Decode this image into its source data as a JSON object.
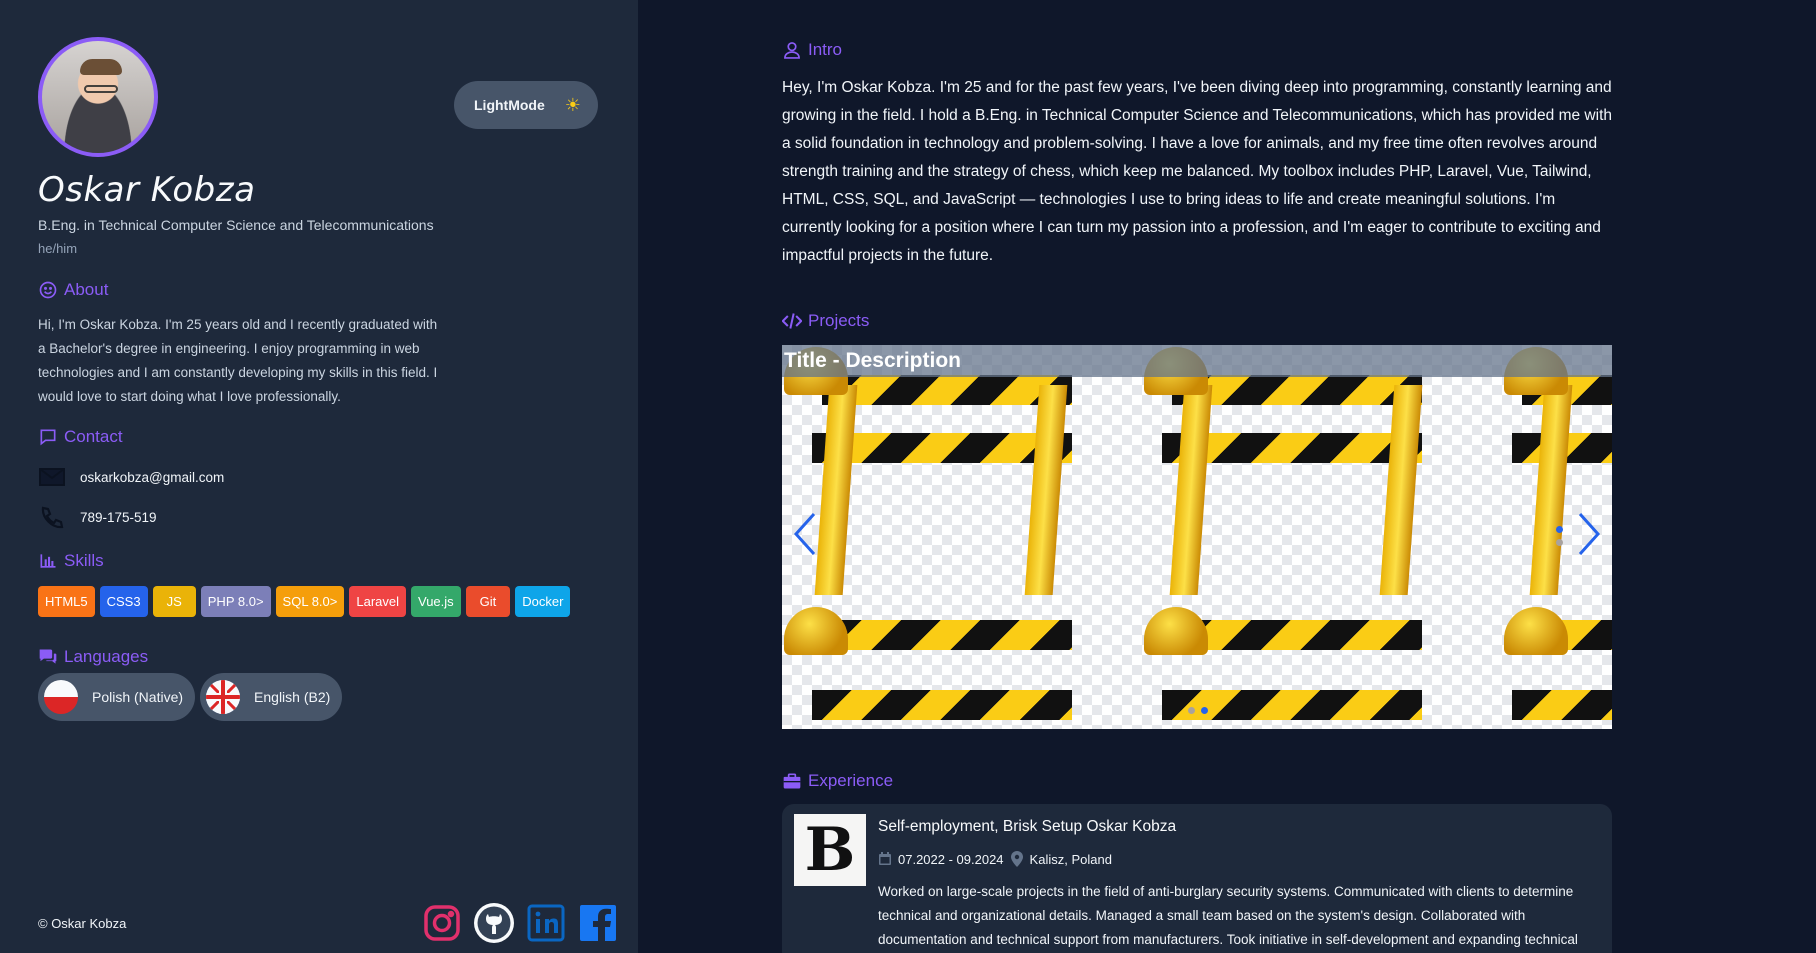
{
  "profile": {
    "name": "Oskar Kobza",
    "degree": "B.Eng. in Technical Computer Science and Telecommunications",
    "pronouns": "he/him"
  },
  "theme_toggle": {
    "label": "LightMode",
    "icon": "sun-icon"
  },
  "about": {
    "heading": "About",
    "text": "Hi, I'm Oskar Kobza. I'm 25 years old and I recently graduated with a Bachelor's degree in engineering. I enjoy programming in web technologies and I am constantly developing my skills in this field. I would love to start doing what I love professionally."
  },
  "contact": {
    "heading": "Contact",
    "email": "oskarkobza@gmail.com",
    "phone": "789-175-519"
  },
  "skills": {
    "heading": "Skills",
    "items": [
      {
        "label": "HTML5",
        "color": "#f97316"
      },
      {
        "label": "CSS3",
        "color": "#2563eb"
      },
      {
        "label": "JS",
        "color": "#eab308"
      },
      {
        "label": "PHP 8.0>",
        "color": "#7c7fb8"
      },
      {
        "label": "SQL 8.0>",
        "color": "#f59e0b"
      },
      {
        "label": "Laravel",
        "color": "#ef4444"
      },
      {
        "label": "Vue.js",
        "color": "#34a86a"
      },
      {
        "label": "Git",
        "color": "#ea4c2c"
      },
      {
        "label": "Docker",
        "color": "#0ea5e9"
      }
    ]
  },
  "languages": {
    "heading": "Languages",
    "items": [
      {
        "label": "Polish (Native)",
        "flag": "poland-flag-icon"
      },
      {
        "label": "English (B2)",
        "flag": "uk-flag-icon"
      }
    ]
  },
  "footer": {
    "copyright": "© Oskar Kobza",
    "socials": [
      "instagram-icon",
      "github-icon",
      "linkedin-icon",
      "facebook-icon"
    ]
  },
  "intro": {
    "heading": "Intro",
    "text": "Hey, I'm Oskar Kobza. I'm 25 and for the past few years, I've been diving deep into programming, constantly learning and growing in the field. I hold a B.Eng. in Technical Computer Science and Telecommunications, which has provided me with a solid foundation in technology and problem-solving. I have a love for animals, and my free time often revolves around strength training and the strategy of chess, which keep me balanced. My toolbox includes PHP, Laravel, Vue, Tailwind, HTML, CSS, SQL, and JavaScript — technologies I use to bring ideas to life and create meaningful solutions. I'm currently looking for a position where I can turn my passion into a profession, and I'm eager to contribute to exciting and impactful projects in the future."
  },
  "projects": {
    "heading": "Projects",
    "slide_title": "Title - Description"
  },
  "experience": {
    "heading": "Experience",
    "items": [
      {
        "logo_letter": "B",
        "title": "Self-employment, Brisk Setup Oskar Kobza",
        "dates": "07.2022 - 09.2024",
        "location": "Kalisz, Poland",
        "description": "Worked on large-scale projects in the field of anti-burglary security systems. Communicated with clients to determine technical and organizational details. Managed a small team based on the system's design. Collaborated with documentation and technical support from manufacturers. Took initiative in self-development and expanding technical"
      }
    ]
  },
  "colors": {
    "accent": "#8b5cf6",
    "sidebar": "#1e293b",
    "main": "#0f172a"
  }
}
